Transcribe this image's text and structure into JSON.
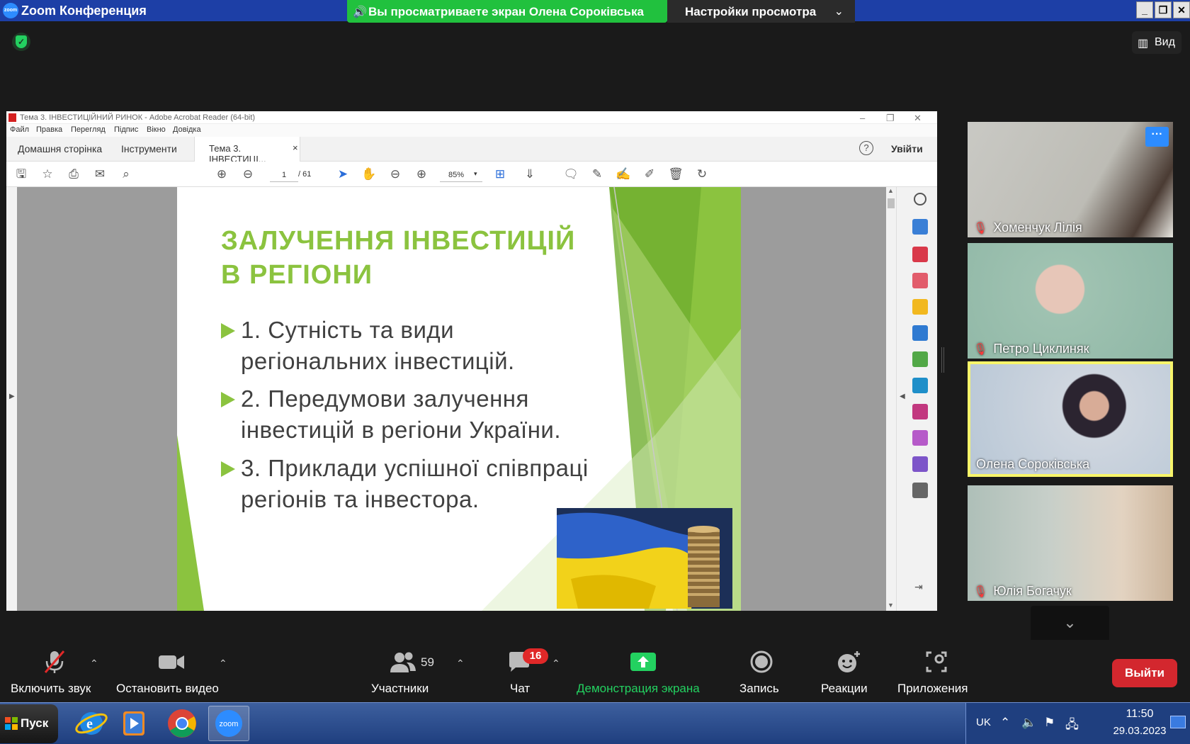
{
  "zoom": {
    "title": "Zoom Конференция",
    "logo_text": "zoom",
    "share_banner": "Вы просматриваете экран Олена Сороківська",
    "view_settings": "Настройки просмотра",
    "view_button": "Вид"
  },
  "acrobat": {
    "window_title": "Тема 3. ІНВЕСТИЦІЙНИЙ РИНОК - Adobe Acrobat Reader (64-bit)",
    "menu": [
      "Файл",
      "Правка",
      "Перегляд",
      "Підпис",
      "Вікно",
      "Довідка"
    ],
    "tab_home": "Домашня сторінка",
    "tab_tools": "Інструменти",
    "tab_doc": "Тема 3. ІНВЕСТИЦІ...",
    "tab_doc_close": "×",
    "help": "?",
    "sign_in": "Увійти",
    "page_current": "1",
    "page_total": "/ 61",
    "zoom_level": "85%"
  },
  "slide": {
    "title": "ЗАЛУЧЕННЯ ІНВЕСТИЦІЙ В РЕГІОНИ",
    "bullets": [
      "1. Сутність та види регіональних інвестицій.",
      "2. Передумови залучення інвестицій в регіони України.",
      "3. Приклади успішної співпраці регіонів та інвестора."
    ],
    "accent_color": "#8bc33f"
  },
  "participants": [
    {
      "name": "Хоменчук Лілія",
      "muted": true
    },
    {
      "name": "Петро Циклиняк",
      "muted": true
    },
    {
      "name": "Олена Сороківська",
      "muted": false,
      "active_speaker": true
    },
    {
      "name": "Юлія Богачук",
      "muted": true
    }
  ],
  "toolbar": {
    "mute": "Включить звук",
    "video": "Остановить видео",
    "participants": "Участники",
    "participants_count": "59",
    "chat": "Чат",
    "chat_badge": "16",
    "share": "Демонстрация экрана",
    "record": "Запись",
    "reactions": "Реакции",
    "apps": "Приложения",
    "leave": "Выйти",
    "share_color": "#23d160",
    "leave_color": "#d3272e"
  },
  "taskbar": {
    "start": "Пуск",
    "apps": [
      "internet-explorer",
      "media-player",
      "chrome",
      "zoom"
    ],
    "zoom_label": "zoom",
    "lang": "UK",
    "time": "11:50",
    "date": "29.03.2023"
  }
}
